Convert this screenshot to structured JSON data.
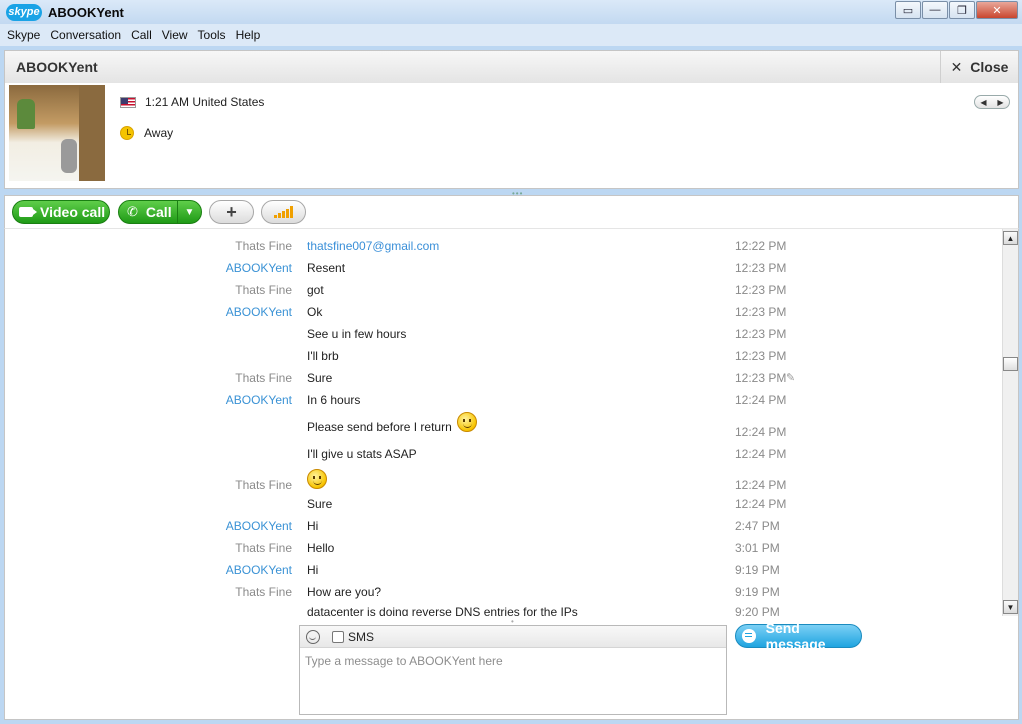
{
  "window": {
    "logo_text": "skype",
    "title": "ABOOKYent",
    "controls": [
      "▭",
      "—",
      "❐",
      "✕"
    ]
  },
  "menu": [
    "Skype",
    "Conversation",
    "Call",
    "View",
    "Tools",
    "Help"
  ],
  "header": {
    "title": "ABOOKYent",
    "close_label": "Close"
  },
  "profile": {
    "local_time": "1:21 AM United States",
    "status": "Away"
  },
  "toolbar": {
    "video_call_label": "Video call",
    "call_label": "Call",
    "add_label": "+"
  },
  "messages": [
    {
      "sender": "Thats Fine",
      "sender_type": "other",
      "text": "thatsfine007@gmail.com",
      "link": true,
      "time": "12:22 PM"
    },
    {
      "sender": "ABOOKYent",
      "sender_type": "self",
      "text": "Resent",
      "time": "12:23 PM"
    },
    {
      "sender": "Thats Fine",
      "sender_type": "other",
      "text": "got",
      "time": "12:23 PM"
    },
    {
      "sender": "ABOOKYent",
      "sender_type": "self",
      "text": "Ok",
      "time": "12:23 PM"
    },
    {
      "sender": "",
      "sender_type": "self",
      "text": "See u in few hours",
      "time": "12:23 PM"
    },
    {
      "sender": "",
      "sender_type": "self",
      "text": "I'll brb",
      "time": "12:23 PM"
    },
    {
      "sender": "Thats Fine",
      "sender_type": "other",
      "text": "Sure",
      "time": "12:23 PM",
      "edited": true
    },
    {
      "sender": "ABOOKYent",
      "sender_type": "self",
      "text": "In 6 hours",
      "time": "12:24 PM"
    },
    {
      "sender": "",
      "sender_type": "self",
      "text": "Please send before I return",
      "smiley": true,
      "time": "12:24 PM"
    },
    {
      "sender": "",
      "sender_type": "self",
      "text": "I'll give u stats ASAP",
      "time": "12:24 PM"
    },
    {
      "sender": "Thats Fine",
      "sender_type": "other",
      "text": "",
      "smiley": true,
      "time": "12:24 PM"
    },
    {
      "sender": "",
      "sender_type": "other",
      "text": "Sure",
      "time": "12:24 PM"
    },
    {
      "sender": "ABOOKYent",
      "sender_type": "self",
      "text": "Hi",
      "time": "2:47 PM"
    },
    {
      "sender": "Thats Fine",
      "sender_type": "other",
      "text": "Hello",
      "time": "3:01 PM"
    },
    {
      "sender": "ABOOKYent",
      "sender_type": "self",
      "text": "Hi",
      "time": "9:19 PM"
    },
    {
      "sender": "Thats Fine",
      "sender_type": "other",
      "text": "How are you?",
      "time": "9:19 PM"
    },
    {
      "sender": "",
      "sender_type": "other",
      "text": "datacenter is doing reverse DNS entries for the IPs",
      "time": "9:20 PM"
    }
  ],
  "compose": {
    "sms_label": "SMS",
    "placeholder": "Type a message to ABOOKYent here",
    "send_label": "Send message"
  },
  "colors": {
    "self_sender": "#3a92d5",
    "other_sender": "#8a8a8a",
    "call_green": "#1f9a16",
    "send_blue": "#1fa4e0"
  }
}
